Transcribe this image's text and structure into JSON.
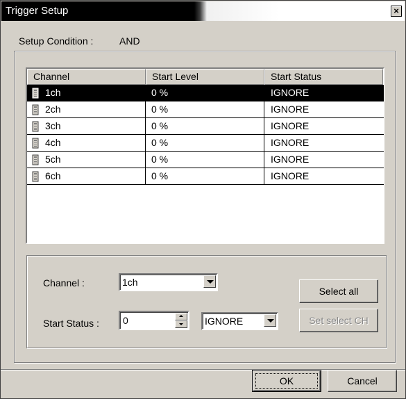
{
  "window": {
    "title": "Trigger Setup",
    "close_label": "×"
  },
  "setup": {
    "condition_label": "Setup Condition :",
    "condition_value": "AND"
  },
  "table": {
    "columns": [
      "Channel",
      "Start Level",
      "Start Status"
    ],
    "rows": [
      {
        "channel": "1ch",
        "level": "0 %",
        "status": "IGNORE",
        "selected": true
      },
      {
        "channel": "2ch",
        "level": "0 %",
        "status": "IGNORE",
        "selected": false
      },
      {
        "channel": "3ch",
        "level": "0 %",
        "status": "IGNORE",
        "selected": false
      },
      {
        "channel": "4ch",
        "level": "0 %",
        "status": "IGNORE",
        "selected": false
      },
      {
        "channel": "5ch",
        "level": "0 %",
        "status": "IGNORE",
        "selected": false
      },
      {
        "channel": "6ch",
        "level": "0 %",
        "status": "IGNORE",
        "selected": false
      }
    ],
    "row_icon": "channel-probe-icon"
  },
  "editor": {
    "channel_label": "Channel :",
    "channel_value": "1ch",
    "start_status_label": "Start Status :",
    "start_status_number": "0",
    "start_status_value": "IGNORE",
    "select_all_label": "Select all",
    "set_select_label": "Set select CH"
  },
  "footer": {
    "ok_label": "OK",
    "cancel_label": "Cancel"
  },
  "colors": {
    "face": "#d4d0c8",
    "selected_row": "#000000",
    "titlebar": "#000000"
  }
}
